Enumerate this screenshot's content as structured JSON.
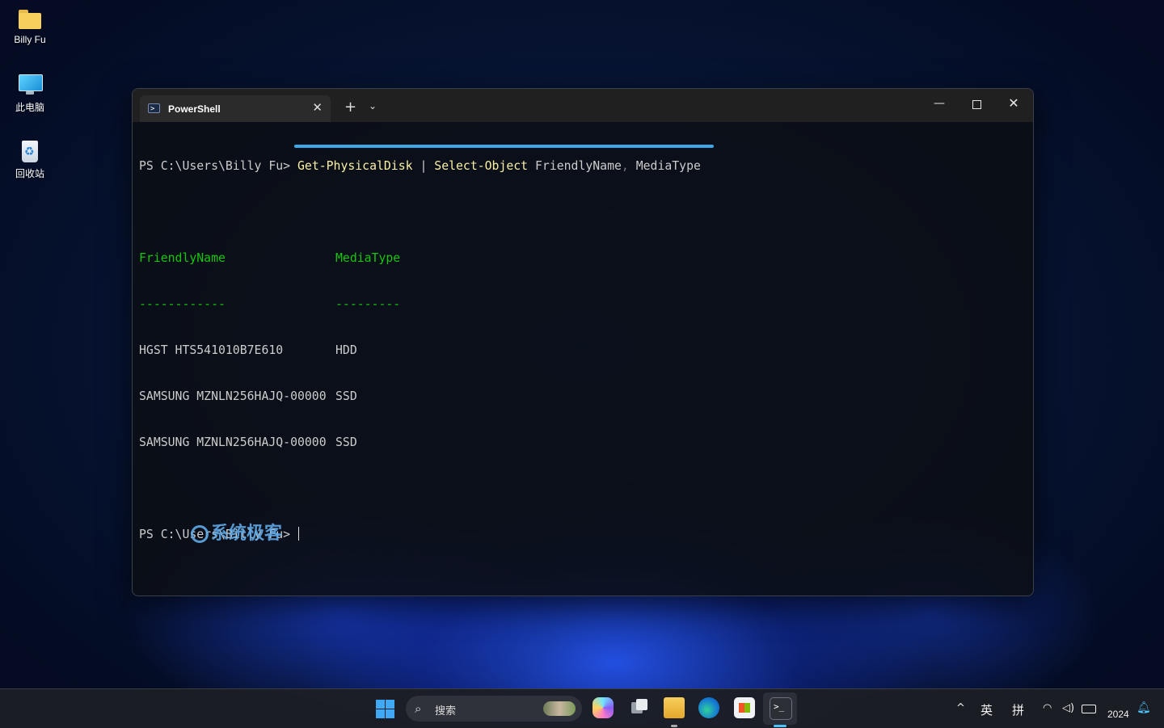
{
  "desktop": {
    "icons": [
      {
        "label": "Billy Fu",
        "icon": "folder-icon"
      },
      {
        "label": "此电脑",
        "icon": "this-pc-icon"
      },
      {
        "label": "回收站",
        "icon": "recycle-bin-icon"
      }
    ]
  },
  "window": {
    "tab_title": "PowerShell",
    "tab_close": "✕",
    "new_tab": "+",
    "dropdown": "⌄",
    "minimize": "—",
    "close": "✕"
  },
  "terminal": {
    "prompt1": "PS C:\\Users\\Billy Fu> ",
    "cmd_part1": "Get-PhysicalDisk",
    "cmd_pipe": " | ",
    "cmd_part2": "Select-Object",
    "cmd_arg1": " FriendlyName",
    "cmd_comma": ",",
    "cmd_arg2": " MediaType",
    "header_name": "FriendlyName",
    "header_type": "MediaType",
    "rule_name": "------------",
    "rule_type": "---------",
    "rows": [
      {
        "name": "HGST HTS541010B7E610",
        "type": "HDD"
      },
      {
        "name": "SAMSUNG MZNLN256HAJQ-00000",
        "type": "SSD"
      },
      {
        "name": "SAMSUNG MZNLN256HAJQ-00000",
        "type": "SSD"
      }
    ],
    "prompt2": "PS C:\\Users\\Billy Fu> "
  },
  "watermark": "系统极客",
  "taskbar": {
    "search_placeholder": "搜索",
    "tray_chevron": "^",
    "ime_lang": "英",
    "ime_mode": "拼",
    "clock": "2024",
    "colors": {
      "accent": "#4cc2ff",
      "start": "#3fa9f5"
    }
  }
}
